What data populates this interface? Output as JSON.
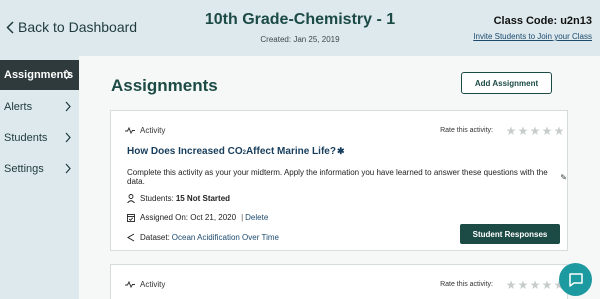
{
  "header": {
    "back_label": "Back to Dashboard",
    "course_title": "10th Grade-Chemistry - 1",
    "created": "Created: Jan 25, 2019",
    "class_code": "Class Code: u2n13",
    "invite_link": "Invite Students to Join your Class"
  },
  "sidebar": {
    "items": [
      {
        "label": "Assignments",
        "active": true
      },
      {
        "label": "Alerts",
        "active": false
      },
      {
        "label": "Students",
        "active": false
      },
      {
        "label": "Settings",
        "active": false
      }
    ]
  },
  "main": {
    "title": "Assignments",
    "add_button": "Add Assignment",
    "cards": [
      {
        "type_label": "Activity",
        "rate_label": "Rate this activity:",
        "rating_stars": 5,
        "rating_value": 0,
        "title_pre": "How Does Increased CO",
        "title_sub": "2",
        "title_post": " Affect Marine Life?",
        "description": "Complete this activity as your your midterm. Apply the information you have learned to answer these questions with the data.",
        "students_label": "Students:",
        "students_value": "15 Not Started",
        "assigned_label": "Assigned On: Oct 21, 2020",
        "separator": "|",
        "delete_label": "Delete",
        "dataset_label": "Dataset:",
        "dataset_value": "Ocean Acidification Over Time",
        "responses_button": "Student Responses"
      },
      {
        "type_label": "Activity",
        "rate_label": "Rate this activity:"
      }
    ]
  },
  "colors": {
    "header_bg": "#dde9ec",
    "accent_dark_green": "#1c4a45",
    "sidebar_active_bg": "#2f3a3c",
    "link_blue": "#1c4a6e",
    "chat_teal": "#1c9aa0"
  },
  "icons": {
    "back": "chevron-left-icon",
    "sidebar_chevron": "chevron-right-icon",
    "activity": "activity-pulse-icon",
    "star": "star-icon",
    "gear": "gear-icon",
    "pencil": "pencil-icon",
    "students": "person-icon",
    "calendar": "calendar-check-icon",
    "dataset": "share-icon",
    "chat": "chat-bubble-icon"
  }
}
